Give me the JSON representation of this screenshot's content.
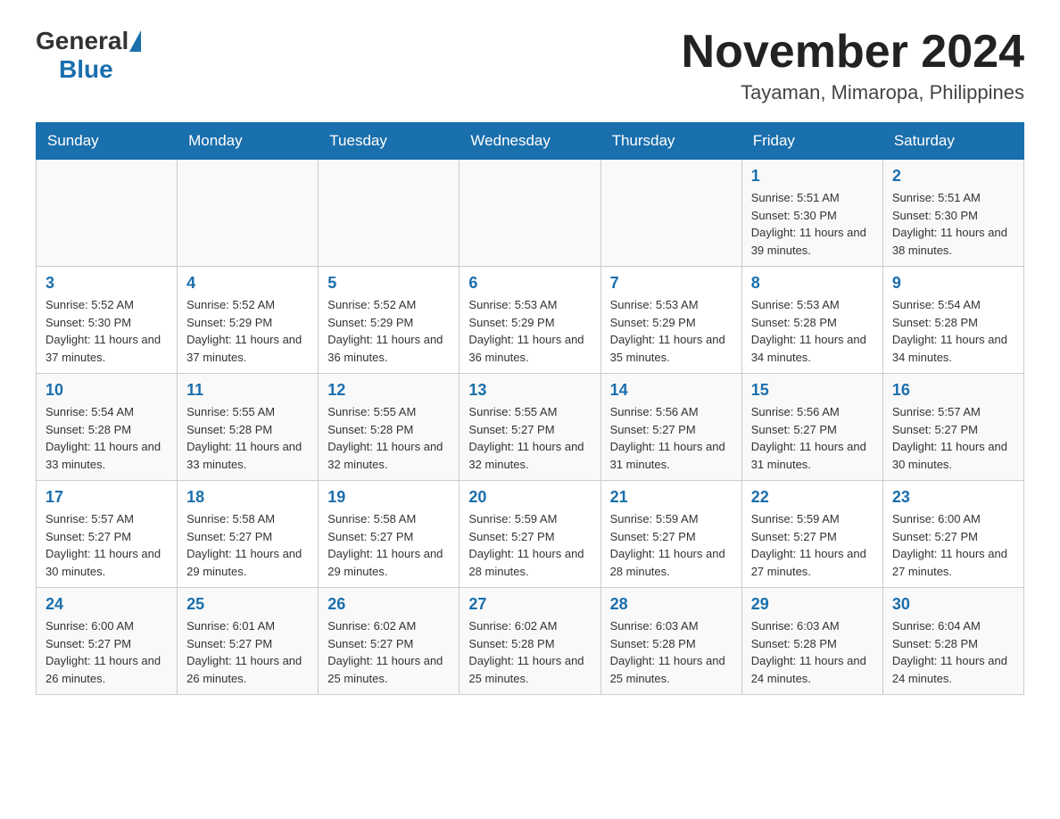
{
  "header": {
    "logo_general": "General",
    "logo_blue": "Blue",
    "title": "November 2024",
    "subtitle": "Tayaman, Mimaropa, Philippines"
  },
  "weekdays": [
    "Sunday",
    "Monday",
    "Tuesday",
    "Wednesday",
    "Thursday",
    "Friday",
    "Saturday"
  ],
  "weeks": [
    [
      {
        "day": "",
        "info": ""
      },
      {
        "day": "",
        "info": ""
      },
      {
        "day": "",
        "info": ""
      },
      {
        "day": "",
        "info": ""
      },
      {
        "day": "",
        "info": ""
      },
      {
        "day": "1",
        "info": "Sunrise: 5:51 AM\nSunset: 5:30 PM\nDaylight: 11 hours and 39 minutes."
      },
      {
        "day": "2",
        "info": "Sunrise: 5:51 AM\nSunset: 5:30 PM\nDaylight: 11 hours and 38 minutes."
      }
    ],
    [
      {
        "day": "3",
        "info": "Sunrise: 5:52 AM\nSunset: 5:30 PM\nDaylight: 11 hours and 37 minutes."
      },
      {
        "day": "4",
        "info": "Sunrise: 5:52 AM\nSunset: 5:29 PM\nDaylight: 11 hours and 37 minutes."
      },
      {
        "day": "5",
        "info": "Sunrise: 5:52 AM\nSunset: 5:29 PM\nDaylight: 11 hours and 36 minutes."
      },
      {
        "day": "6",
        "info": "Sunrise: 5:53 AM\nSunset: 5:29 PM\nDaylight: 11 hours and 36 minutes."
      },
      {
        "day": "7",
        "info": "Sunrise: 5:53 AM\nSunset: 5:29 PM\nDaylight: 11 hours and 35 minutes."
      },
      {
        "day": "8",
        "info": "Sunrise: 5:53 AM\nSunset: 5:28 PM\nDaylight: 11 hours and 34 minutes."
      },
      {
        "day": "9",
        "info": "Sunrise: 5:54 AM\nSunset: 5:28 PM\nDaylight: 11 hours and 34 minutes."
      }
    ],
    [
      {
        "day": "10",
        "info": "Sunrise: 5:54 AM\nSunset: 5:28 PM\nDaylight: 11 hours and 33 minutes."
      },
      {
        "day": "11",
        "info": "Sunrise: 5:55 AM\nSunset: 5:28 PM\nDaylight: 11 hours and 33 minutes."
      },
      {
        "day": "12",
        "info": "Sunrise: 5:55 AM\nSunset: 5:28 PM\nDaylight: 11 hours and 32 minutes."
      },
      {
        "day": "13",
        "info": "Sunrise: 5:55 AM\nSunset: 5:27 PM\nDaylight: 11 hours and 32 minutes."
      },
      {
        "day": "14",
        "info": "Sunrise: 5:56 AM\nSunset: 5:27 PM\nDaylight: 11 hours and 31 minutes."
      },
      {
        "day": "15",
        "info": "Sunrise: 5:56 AM\nSunset: 5:27 PM\nDaylight: 11 hours and 31 minutes."
      },
      {
        "day": "16",
        "info": "Sunrise: 5:57 AM\nSunset: 5:27 PM\nDaylight: 11 hours and 30 minutes."
      }
    ],
    [
      {
        "day": "17",
        "info": "Sunrise: 5:57 AM\nSunset: 5:27 PM\nDaylight: 11 hours and 30 minutes."
      },
      {
        "day": "18",
        "info": "Sunrise: 5:58 AM\nSunset: 5:27 PM\nDaylight: 11 hours and 29 minutes."
      },
      {
        "day": "19",
        "info": "Sunrise: 5:58 AM\nSunset: 5:27 PM\nDaylight: 11 hours and 29 minutes."
      },
      {
        "day": "20",
        "info": "Sunrise: 5:59 AM\nSunset: 5:27 PM\nDaylight: 11 hours and 28 minutes."
      },
      {
        "day": "21",
        "info": "Sunrise: 5:59 AM\nSunset: 5:27 PM\nDaylight: 11 hours and 28 minutes."
      },
      {
        "day": "22",
        "info": "Sunrise: 5:59 AM\nSunset: 5:27 PM\nDaylight: 11 hours and 27 minutes."
      },
      {
        "day": "23",
        "info": "Sunrise: 6:00 AM\nSunset: 5:27 PM\nDaylight: 11 hours and 27 minutes."
      }
    ],
    [
      {
        "day": "24",
        "info": "Sunrise: 6:00 AM\nSunset: 5:27 PM\nDaylight: 11 hours and 26 minutes."
      },
      {
        "day": "25",
        "info": "Sunrise: 6:01 AM\nSunset: 5:27 PM\nDaylight: 11 hours and 26 minutes."
      },
      {
        "day": "26",
        "info": "Sunrise: 6:02 AM\nSunset: 5:27 PM\nDaylight: 11 hours and 25 minutes."
      },
      {
        "day": "27",
        "info": "Sunrise: 6:02 AM\nSunset: 5:28 PM\nDaylight: 11 hours and 25 minutes."
      },
      {
        "day": "28",
        "info": "Sunrise: 6:03 AM\nSunset: 5:28 PM\nDaylight: 11 hours and 25 minutes."
      },
      {
        "day": "29",
        "info": "Sunrise: 6:03 AM\nSunset: 5:28 PM\nDaylight: 11 hours and 24 minutes."
      },
      {
        "day": "30",
        "info": "Sunrise: 6:04 AM\nSunset: 5:28 PM\nDaylight: 11 hours and 24 minutes."
      }
    ]
  ]
}
